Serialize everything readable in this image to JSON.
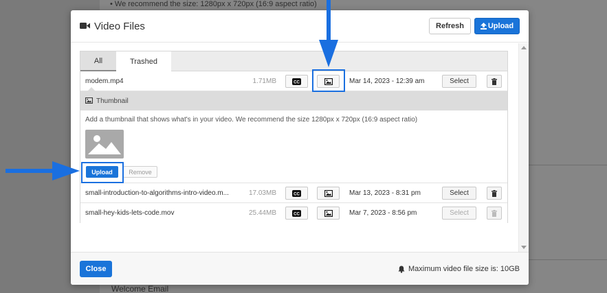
{
  "background": {
    "top_text": "•  We recommend the size: 1280px x 720px (16:9 aspect ratio)",
    "bottom_text": "Welcome Email"
  },
  "modal": {
    "title": "Video Files",
    "title_icon": "video-camera-icon",
    "refresh_label": "Refresh",
    "upload_label": "Upload",
    "upload_icon": "upload-icon"
  },
  "tabs": [
    {
      "label": "All",
      "active": true
    },
    {
      "label": "Trashed",
      "active": false
    }
  ],
  "files": [
    {
      "name": "modem.mp4",
      "size": "1.71MB",
      "date": "Mar 14, 2023 - 12:39 am",
      "select_label": "Select",
      "select_enabled": true,
      "trash_enabled": true
    },
    {
      "name": "small-introduction-to-algorithms-intro-video.m...",
      "size": "17.03MB",
      "date": "Mar 13, 2023 - 8:31 pm",
      "select_label": "Select",
      "select_enabled": true,
      "trash_enabled": true
    },
    {
      "name": "small-hey-kids-lets-code.mov",
      "size": "25.44MB",
      "date": "Mar 7, 2023 - 8:56 pm",
      "select_label": "Select",
      "select_enabled": false,
      "trash_enabled": false
    }
  ],
  "thumbnail": {
    "header": "Thumbnail",
    "description": "Add a thumbnail that shows what's in your video. We recommend the size 1280px x 720px (16:9 aspect ratio)",
    "upload_label": "Upload",
    "remove_label": "Remove"
  },
  "footer": {
    "close_label": "Close",
    "max_size_text": "Maximum video file size is: 10GB",
    "bell_icon": "bell-icon"
  },
  "colors": {
    "accent": "#1a74d9",
    "annotation": "#1a6fe0"
  }
}
